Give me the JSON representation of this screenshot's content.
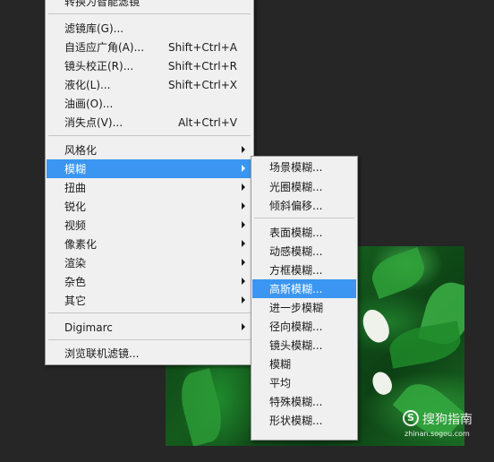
{
  "main_menu": {
    "truncated_top": "转换为智能滤镜",
    "group1": [
      {
        "label": "滤镜库(G)...",
        "shortcut": ""
      },
      {
        "label": "自适应广角(A)...",
        "shortcut": "Shift+Ctrl+A"
      },
      {
        "label": "镜头校正(R)...",
        "shortcut": "Shift+Ctrl+R"
      },
      {
        "label": "液化(L)...",
        "shortcut": "Shift+Ctrl+X"
      },
      {
        "label": "油画(O)...",
        "shortcut": ""
      },
      {
        "label": "消失点(V)...",
        "shortcut": "Alt+Ctrl+V"
      }
    ],
    "group2": [
      {
        "label": "风格化"
      },
      {
        "label": "模糊"
      },
      {
        "label": "扭曲"
      },
      {
        "label": "锐化"
      },
      {
        "label": "视频"
      },
      {
        "label": "像素化"
      },
      {
        "label": "渲染"
      },
      {
        "label": "杂色"
      },
      {
        "label": "其它"
      }
    ],
    "group3": [
      {
        "label": "Digimarc"
      }
    ],
    "group4": [
      {
        "label": "浏览联机滤镜..."
      }
    ],
    "highlighted": "模糊"
  },
  "blur_submenu": {
    "group1": [
      "场景模糊...",
      "光圈模糊...",
      "倾斜偏移..."
    ],
    "group2": [
      "表面模糊...",
      "动感模糊...",
      "方框模糊...",
      "高斯模糊...",
      "进一步模糊",
      "径向模糊...",
      "镜头模糊...",
      "模糊",
      "平均",
      "特殊模糊...",
      "形状模糊..."
    ],
    "highlighted": "高斯模糊..."
  },
  "watermark": {
    "text": "搜狗指南",
    "url": "zhinan.sogou.com",
    "icon": "S"
  },
  "colors": {
    "background": "#262626",
    "menu_bg": "#f0f0f0",
    "highlight": "#3a96f0"
  }
}
